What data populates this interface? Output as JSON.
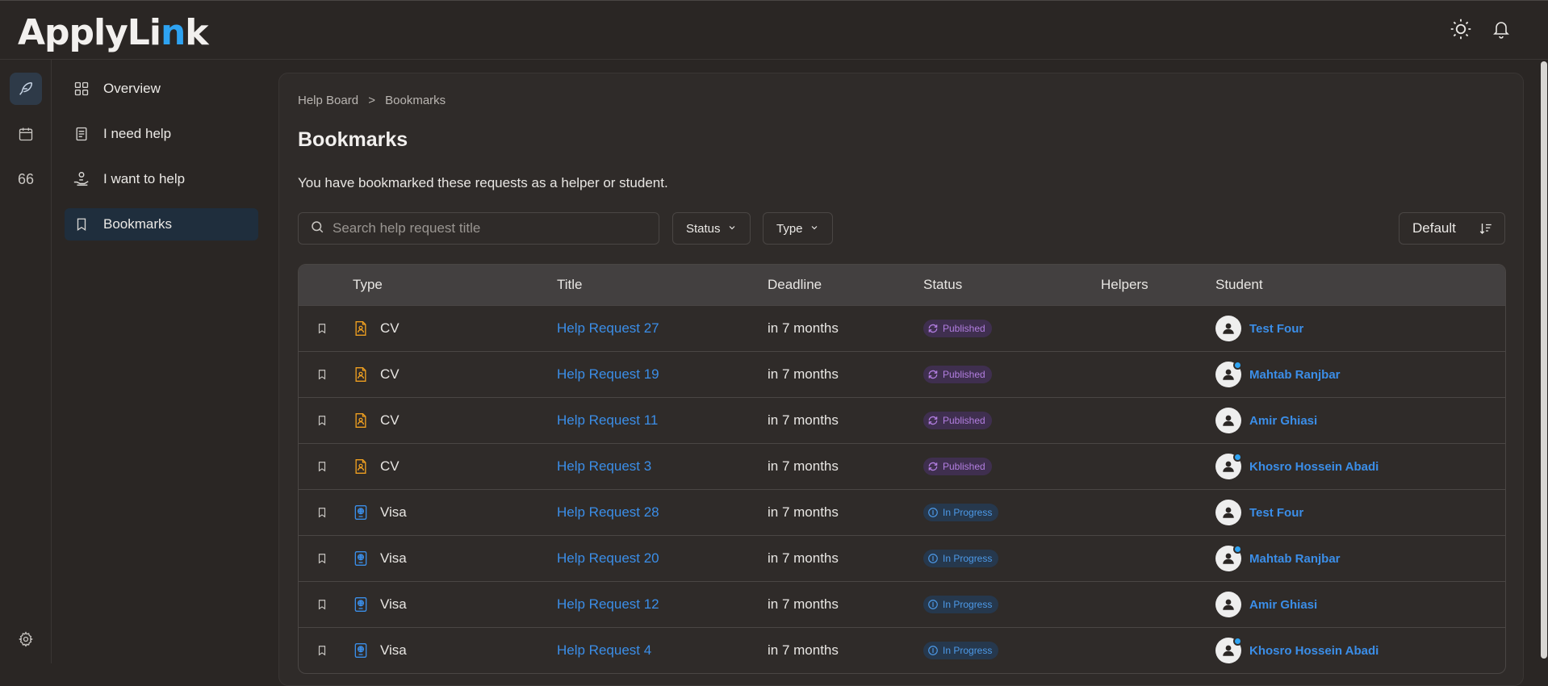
{
  "app": {
    "logo_main": "ApplyLi",
    "logo_accent": "n",
    "logo_end": "k"
  },
  "sidebar": {
    "items": [
      {
        "label": "Overview",
        "icon": "grid-icon"
      },
      {
        "label": "I need help",
        "icon": "document-icon"
      },
      {
        "label": "I want to help",
        "icon": "helping-hand-icon"
      },
      {
        "label": "Bookmarks",
        "icon": "bookmark-icon"
      }
    ]
  },
  "rail": {
    "counter": "66"
  },
  "breadcrumb": {
    "root": "Help Board",
    "separator": ">",
    "current": "Bookmarks"
  },
  "page": {
    "title": "Bookmarks",
    "description": "You have bookmarked these requests as a helper or student."
  },
  "toolbar": {
    "search_placeholder": "Search help request title",
    "status_label": "Status",
    "type_label": "Type",
    "sort_label": "Default"
  },
  "table": {
    "columns": [
      "Type",
      "Title",
      "Deadline",
      "Status",
      "Helpers",
      "Student"
    ],
    "rows": [
      {
        "type": "CV",
        "title": "Help Request 27",
        "deadline": "in 7 months",
        "status": "Published",
        "student": "Test Four",
        "online": false
      },
      {
        "type": "CV",
        "title": "Help Request 19",
        "deadline": "in 7 months",
        "status": "Published",
        "student": "Mahtab Ranjbar",
        "online": true
      },
      {
        "type": "CV",
        "title": "Help Request 11",
        "deadline": "in 7 months",
        "status": "Published",
        "student": "Amir Ghiasi",
        "online": false
      },
      {
        "type": "CV",
        "title": "Help Request 3",
        "deadline": "in 7 months",
        "status": "Published",
        "student": "Khosro Hossein Abadi",
        "online": true
      },
      {
        "type": "Visa",
        "title": "Help Request 28",
        "deadline": "in 7 months",
        "status": "In Progress",
        "student": "Test Four",
        "online": false
      },
      {
        "type": "Visa",
        "title": "Help Request 20",
        "deadline": "in 7 months",
        "status": "In Progress",
        "student": "Mahtab Ranjbar",
        "online": true
      },
      {
        "type": "Visa",
        "title": "Help Request 12",
        "deadline": "in 7 months",
        "status": "In Progress",
        "student": "Amir Ghiasi",
        "online": false
      },
      {
        "type": "Visa",
        "title": "Help Request 4",
        "deadline": "in 7 months",
        "status": "In Progress",
        "student": "Khosro Hossein Abadi",
        "online": true
      }
    ]
  },
  "colors": {
    "accent": "#2ea3f2",
    "link": "#3b8ee8",
    "published": "#b27ee0",
    "in_progress": "#4d9ae8",
    "cv_icon": "#f0a020"
  }
}
